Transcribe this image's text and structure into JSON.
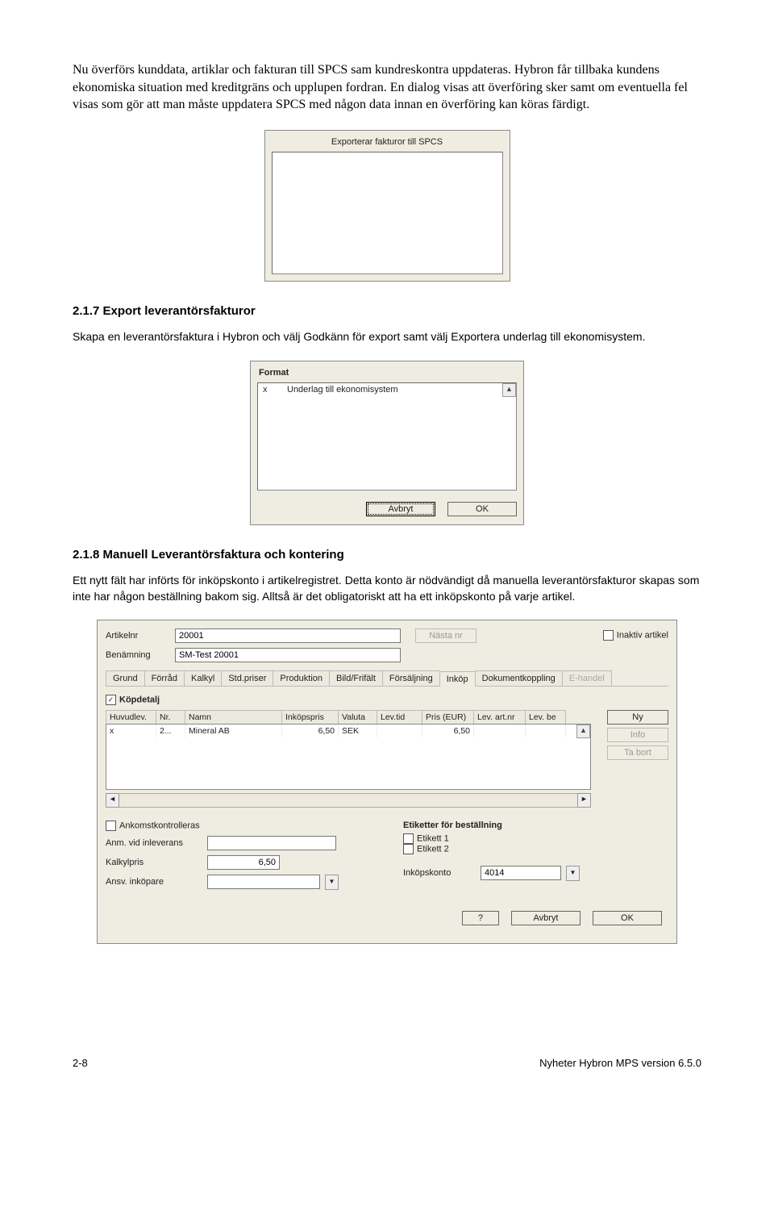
{
  "intro": {
    "p1": "Nu överförs kunddata, artiklar och fakturan till SPCS sam kundreskontra uppdateras. Hybron får tillbaka kundens ekonomiska situation med kreditgräns och upplupen fordran. En dialog visas att överföring sker samt om eventuella fel visas som gör att man måste uppdatera SPCS med någon data innan en överföring kan köras färdigt."
  },
  "dialog1": {
    "title": "Exporterar fakturor till SPCS"
  },
  "sec217": {
    "heading": "2.1.7  Export leverantörsfakturor",
    "text": "Skapa en leverantörsfaktura i Hybron och välj Godkänn för export samt välj Exportera underlag till ekonomisystem."
  },
  "dialog2": {
    "label": "Format",
    "row_mark": "x",
    "row_text": "Underlag till ekonomisystem",
    "btn_cancel": "Avbryt",
    "btn_ok": "OK"
  },
  "sec218": {
    "heading": "2.1.8  Manuell Leverantörsfaktura och kontering",
    "text": "Ett nytt fält har införts för inköpskonto i artikelregistret. Detta konto är nödvändigt då manuella leverantörsfakturor skapas som inte har någon beställning bakom sig. Alltså är det obligatoriskt att ha ett inköpskonto på varje artikel."
  },
  "article": {
    "lbl_artnr": "Artikelnr",
    "artnr": "20001",
    "lbl_benamn": "Benämning",
    "benamn": "SM-Test 20001",
    "btn_next": "Nästa nr",
    "chk_inactive": "Inaktiv artikel",
    "tabs": [
      "Grund",
      "Förråd",
      "Kalkyl",
      "Std.priser",
      "Produktion",
      "Bild/Frifält",
      "Försäljning",
      "Inköp",
      "Dokumentkoppling",
      "E-handel"
    ],
    "active_tab": "Inköp",
    "disabled_tab": "E-handel",
    "chk_kopdetalj": "Köpdetalj",
    "headers": [
      "Huvudlev.",
      "Nr.",
      "Namn",
      "Inköpspris",
      "Valuta",
      "Lev.tid",
      "Pris (EUR)",
      "Lev. art.nr",
      "Lev. be"
    ],
    "row": {
      "huv": "x",
      "nr": "2...",
      "namn": "Mineral AB",
      "pris": "6,50",
      "val": "SEK",
      "tid": "",
      "eur": "6,50",
      "art": "",
      "be": ""
    },
    "btn_ny": "Ny",
    "btn_info": "Info",
    "btn_tabort": "Ta bort",
    "chk_ankomst": "Ankomstkontrolleras",
    "lbl_anm": "Anm. vid inleverans",
    "lbl_kalk": "Kalkylpris",
    "kalk": "6,50",
    "lbl_ansv": "Ansv. inköpare",
    "etik_head": "Etiketter för beställning",
    "etik1": "Etikett 1",
    "etik2": "Etikett 2",
    "lbl_inkkonto": "Inköpskonto",
    "inkkonto": "4014",
    "btn_q": "?",
    "btn_cancel": "Avbryt",
    "btn_ok": "OK"
  },
  "footer": {
    "left": "2-8",
    "right": "Nyheter Hybron MPS version 6.5.0"
  }
}
